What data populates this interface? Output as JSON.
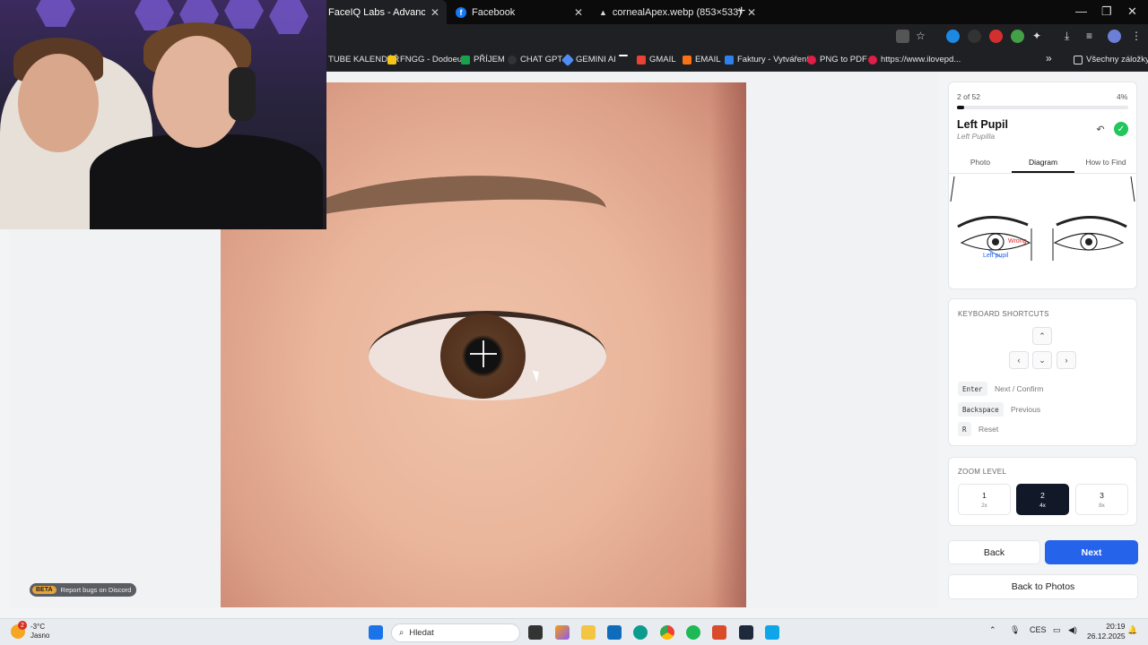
{
  "browser": {
    "tabs": [
      {
        "label": "FaceIQ Labs - Advanced Facial A",
        "active": true
      },
      {
        "label": "Facebook",
        "active": false
      },
      {
        "label": "cornealApex.webp (853×533)",
        "active": false
      }
    ],
    "bookmarks": [
      {
        "label": "TUBE KALENDÁŘ",
        "color": "#1f2023"
      },
      {
        "label": "FNGG - Dodoeu",
        "color": "#f5c518"
      },
      {
        "label": "PŘÍJEM",
        "color": "#16a34a"
      },
      {
        "label": "CHAT GPT",
        "color": "#333333"
      },
      {
        "label": "GEMINI AI",
        "color": "#4f8df5"
      },
      {
        "label": "",
        "color": "#ffffff"
      },
      {
        "label": "GMAIL",
        "color": "#ea4335"
      },
      {
        "label": "EMAIL",
        "color": "#f97316"
      },
      {
        "label": "Faktury - Vytváření",
        "color": "#2f80ed"
      },
      {
        "label": "PNG to PDF",
        "color": "#e11d48"
      },
      {
        "label": "https://www.ilovepd...",
        "color": "#e11d48"
      }
    ],
    "bookmarks_overflow": "»",
    "all_bookmarks": "Všechny záložky"
  },
  "progress": {
    "position": "2 of 52",
    "percent": "4%",
    "fill": 0.04
  },
  "landmark": {
    "title": "Left Pupil",
    "subtitle": "Left Pupilla"
  },
  "tabs": {
    "photo": "Photo",
    "diagram": "Diagram",
    "how_to_find": "How to Find",
    "active": "Diagram"
  },
  "diagram": {
    "wrong_label": "Wrong",
    "left_pupil_label": "Left pupil"
  },
  "shortcuts": {
    "title": "KEYBOARD SHORTCUTS",
    "items": [
      {
        "key": "Enter",
        "desc": "Next / Confirm"
      },
      {
        "key": "Backspace",
        "desc": "Previous"
      },
      {
        "key": "R",
        "desc": "Reset"
      }
    ]
  },
  "zoom": {
    "title": "ZOOM LEVEL",
    "levels": [
      {
        "n": "1",
        "mult": "2x",
        "active": false
      },
      {
        "n": "2",
        "mult": "4x",
        "active": true
      },
      {
        "n": "3",
        "mult": "8x",
        "active": false
      }
    ]
  },
  "buttons": {
    "back": "Back",
    "next": "Next",
    "back_to_photos": "Back to Photos"
  },
  "beta": {
    "tag": "BETA",
    "text": "Report bugs on Discord"
  },
  "taskbar": {
    "weather_temp": "-3°C",
    "weather_desc": "Jasno",
    "weather_badge": "2",
    "search_placeholder": "Hledat",
    "lang": "CES",
    "time": "20:19",
    "date": "26.12.2025"
  },
  "colors": {
    "accent": "#2563eb",
    "success": "#22c55e",
    "active_zoom": "#111827"
  }
}
